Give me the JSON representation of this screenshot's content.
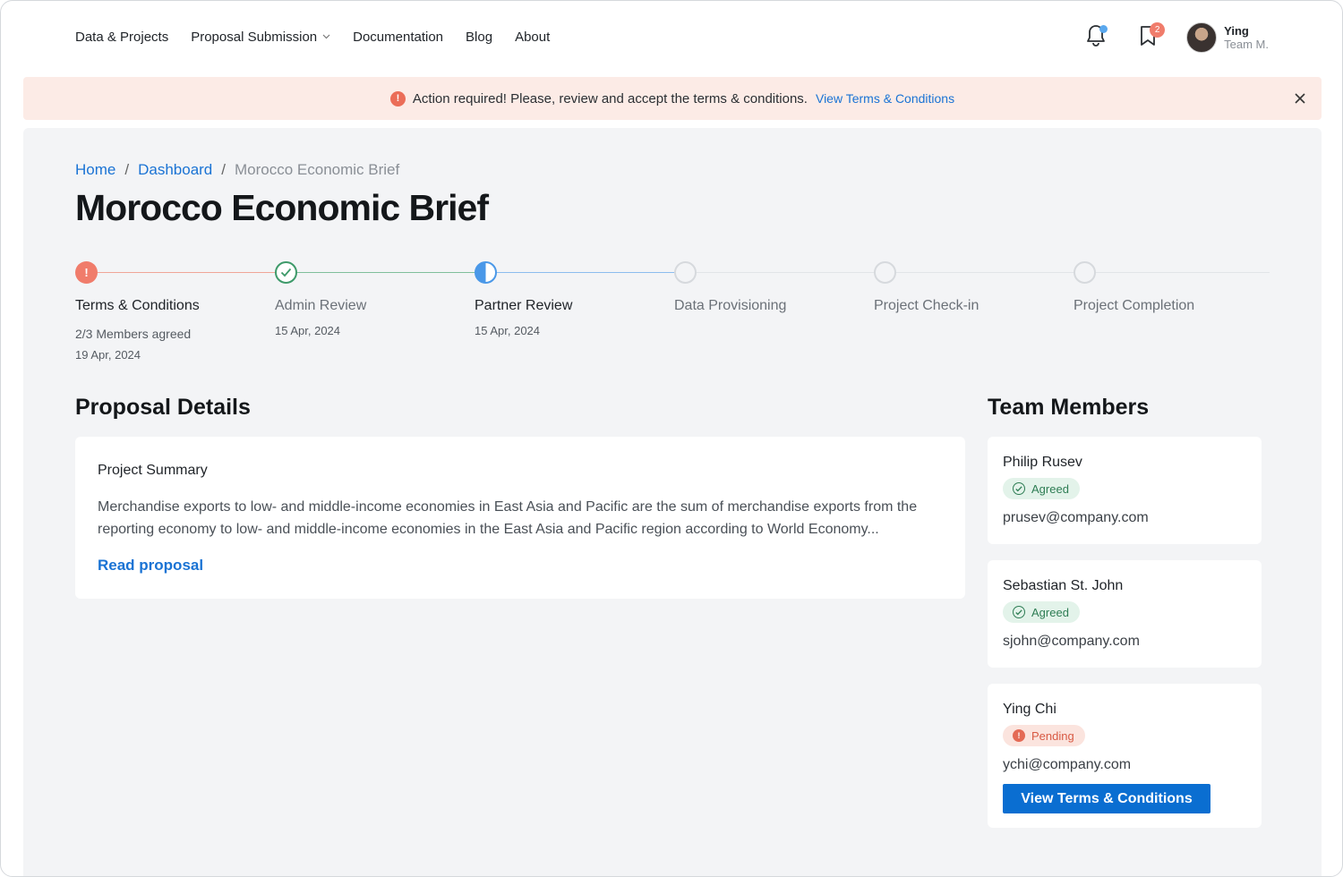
{
  "nav": {
    "links": [
      "Data & Projects",
      "Proposal Submission",
      "Documentation",
      "Blog",
      "About"
    ],
    "notifications_icon": "bell-icon",
    "bookmark_icon": "bookmark-icon",
    "bookmark_count": "2",
    "user": {
      "name": "Ying",
      "team": "Team M."
    }
  },
  "alert": {
    "text": "Action required! Please, review and accept the terms & conditions.",
    "link": "View Terms & Conditions",
    "icon_text": "!",
    "close": "✕"
  },
  "breadcrumb": {
    "home": "Home",
    "dashboard": "Dashboard",
    "current": "Morocco Economic Brief",
    "sep": "/"
  },
  "page_title": "Morocco Economic Brief",
  "steps": [
    {
      "label": "Terms & Conditions",
      "status": "error",
      "sub": "2/3 Members agreed",
      "date": "19 Apr, 2024",
      "icon_text": "!"
    },
    {
      "label": "Admin Review",
      "status": "done",
      "date": "15 Apr, 2024"
    },
    {
      "label": "Partner Review",
      "status": "in-progress",
      "date": "15 Apr, 2024"
    },
    {
      "label": "Data Provisioning",
      "status": "todo"
    },
    {
      "label": "Project Check-in",
      "status": "todo"
    },
    {
      "label": "Project Completion",
      "status": "todo"
    }
  ],
  "proposal": {
    "heading": "Proposal Details",
    "summary_title": "Project Summary",
    "summary_text": "Merchandise exports to low- and middle-income economies in East Asia and Pacific are the sum of merchandise exports from the reporting economy to low- and middle-income economies in the East Asia and Pacific region according to World Economy...",
    "read_link": "Read proposal"
  },
  "team": {
    "heading": "Team Members",
    "members": [
      {
        "name": "Philip Rusev",
        "status": "Agreed",
        "email": "prusev@company.com"
      },
      {
        "name": "Sebastian St. John",
        "status": "Agreed",
        "email": "sjohn@company.com"
      },
      {
        "name": "Ying Chi",
        "status": "Pending",
        "email": "ychi@company.com",
        "action": "View Terms & Conditions"
      }
    ],
    "pending_icon_text": "!"
  },
  "colors": {
    "accent": "#1a73d4",
    "error": "#f07c6b",
    "success": "#3e9a6a",
    "progress": "#4a98e8",
    "alert_bg": "#fcebe6",
    "main_bg": "#f3f4f6"
  }
}
